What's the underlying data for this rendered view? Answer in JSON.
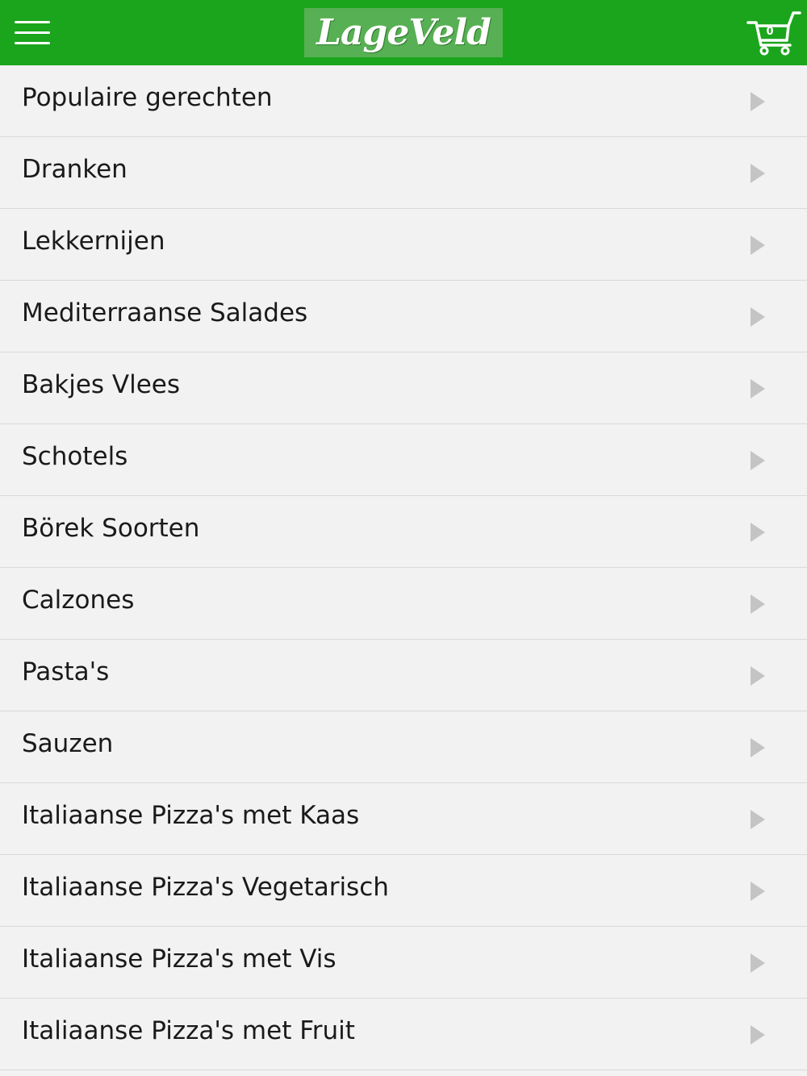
{
  "header": {
    "logo_text": "LageVeld",
    "cart_count": "0",
    "brand_color": "#1aa51c",
    "menu_icon": "hamburger-icon",
    "cart_icon": "shopping-cart-icon"
  },
  "categories": [
    {
      "label": "Populaire gerechten"
    },
    {
      "label": "Dranken"
    },
    {
      "label": "Lekkernijen"
    },
    {
      "label": "Mediterraanse Salades"
    },
    {
      "label": "Bakjes Vlees"
    },
    {
      "label": "Schotels"
    },
    {
      "label": "Börek Soorten"
    },
    {
      "label": "Calzones"
    },
    {
      "label": "Pasta's"
    },
    {
      "label": "Sauzen"
    },
    {
      "label": "Italiaanse Pizza's met Kaas"
    },
    {
      "label": "Italiaanse Pizza's Vegetarisch"
    },
    {
      "label": "Italiaanse Pizza's met Vis"
    },
    {
      "label": "Italiaanse Pizza's met Fruit"
    }
  ]
}
